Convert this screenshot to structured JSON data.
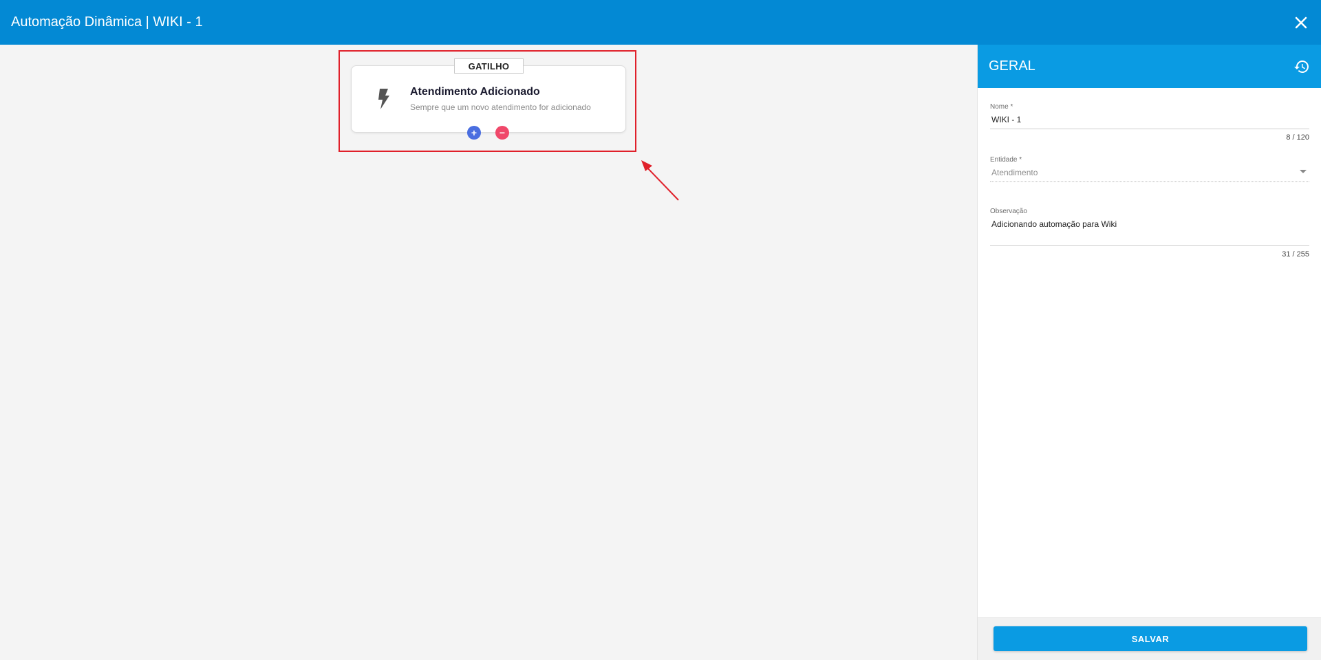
{
  "header": {
    "title": "Automação Dinâmica | WIKI - 1",
    "close_icon": "close-icon"
  },
  "canvas": {
    "trigger_badge": "GATILHO",
    "trigger_title": "Atendimento Adicionado",
    "trigger_description": "Sempre que um novo atendimento for adicionado",
    "trigger_icon": "lightning-bolt-icon",
    "add_symbol": "+",
    "remove_symbol": "−"
  },
  "panel": {
    "title": "GERAL",
    "history_icon": "history-icon",
    "name": {
      "label": "Nome *",
      "value": "WIKI - 1",
      "counter": "8 / 120"
    },
    "entity": {
      "label": "Entidade *",
      "value": "Atendimento"
    },
    "observation": {
      "label": "Observação",
      "value": "Adicionando automação para Wiki",
      "counter": "31 / 255"
    },
    "save_label": "SALVAR"
  },
  "colors": {
    "header": "#0389d4",
    "panel_header": "#0a9be3",
    "highlight": "#e0202a",
    "add_button": "#4a6ee0",
    "remove_button": "#f0486a"
  }
}
